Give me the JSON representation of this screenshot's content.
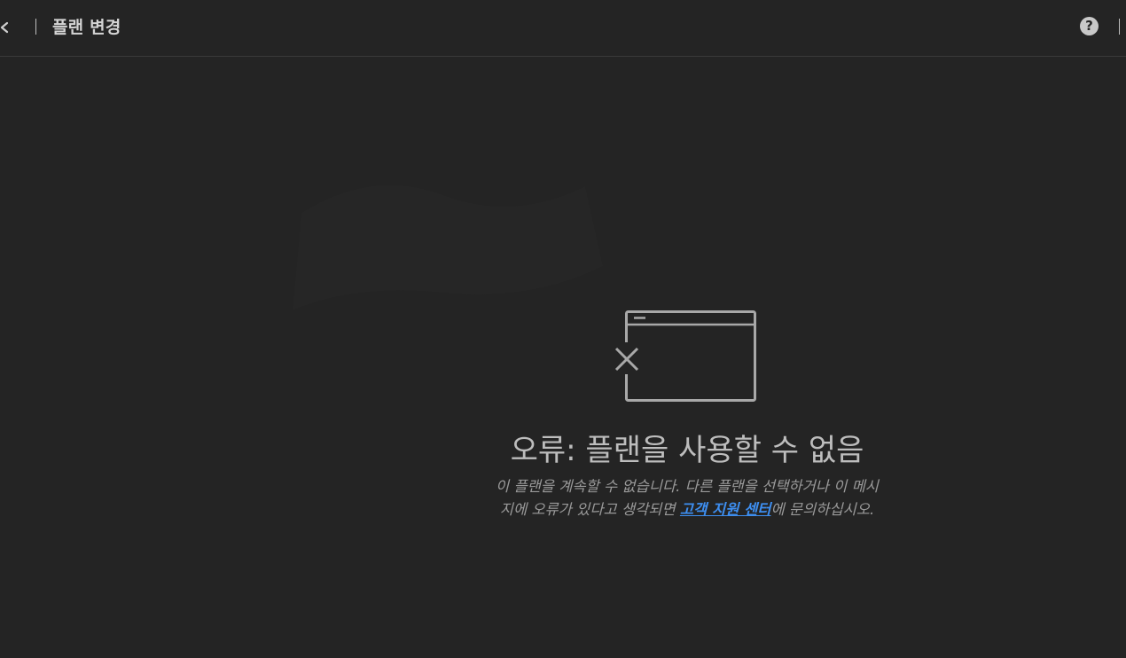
{
  "header": {
    "title": "플랜 변경",
    "help_glyph": "?"
  },
  "error": {
    "title": "오류: 플랜을 사용할 수 없음",
    "description_line1": "이 플랜을 계속할 수 없습니다. 다른 플랜을 선택하거나 이 메시",
    "description_line2_prefix": "지에 오류가 있다고 생각되면 ",
    "support_link": "고객 지원 센터",
    "description_line2_suffix": "에 문의하십시오."
  },
  "icons": {
    "back": "chevron-left-icon",
    "help": "question-circle-icon",
    "illustration": "window-error-icon"
  },
  "colors": {
    "background": "#242424",
    "link": "#3d8ef0",
    "text_primary": "#bdbdbd",
    "text_secondary": "#9a9a9a"
  }
}
